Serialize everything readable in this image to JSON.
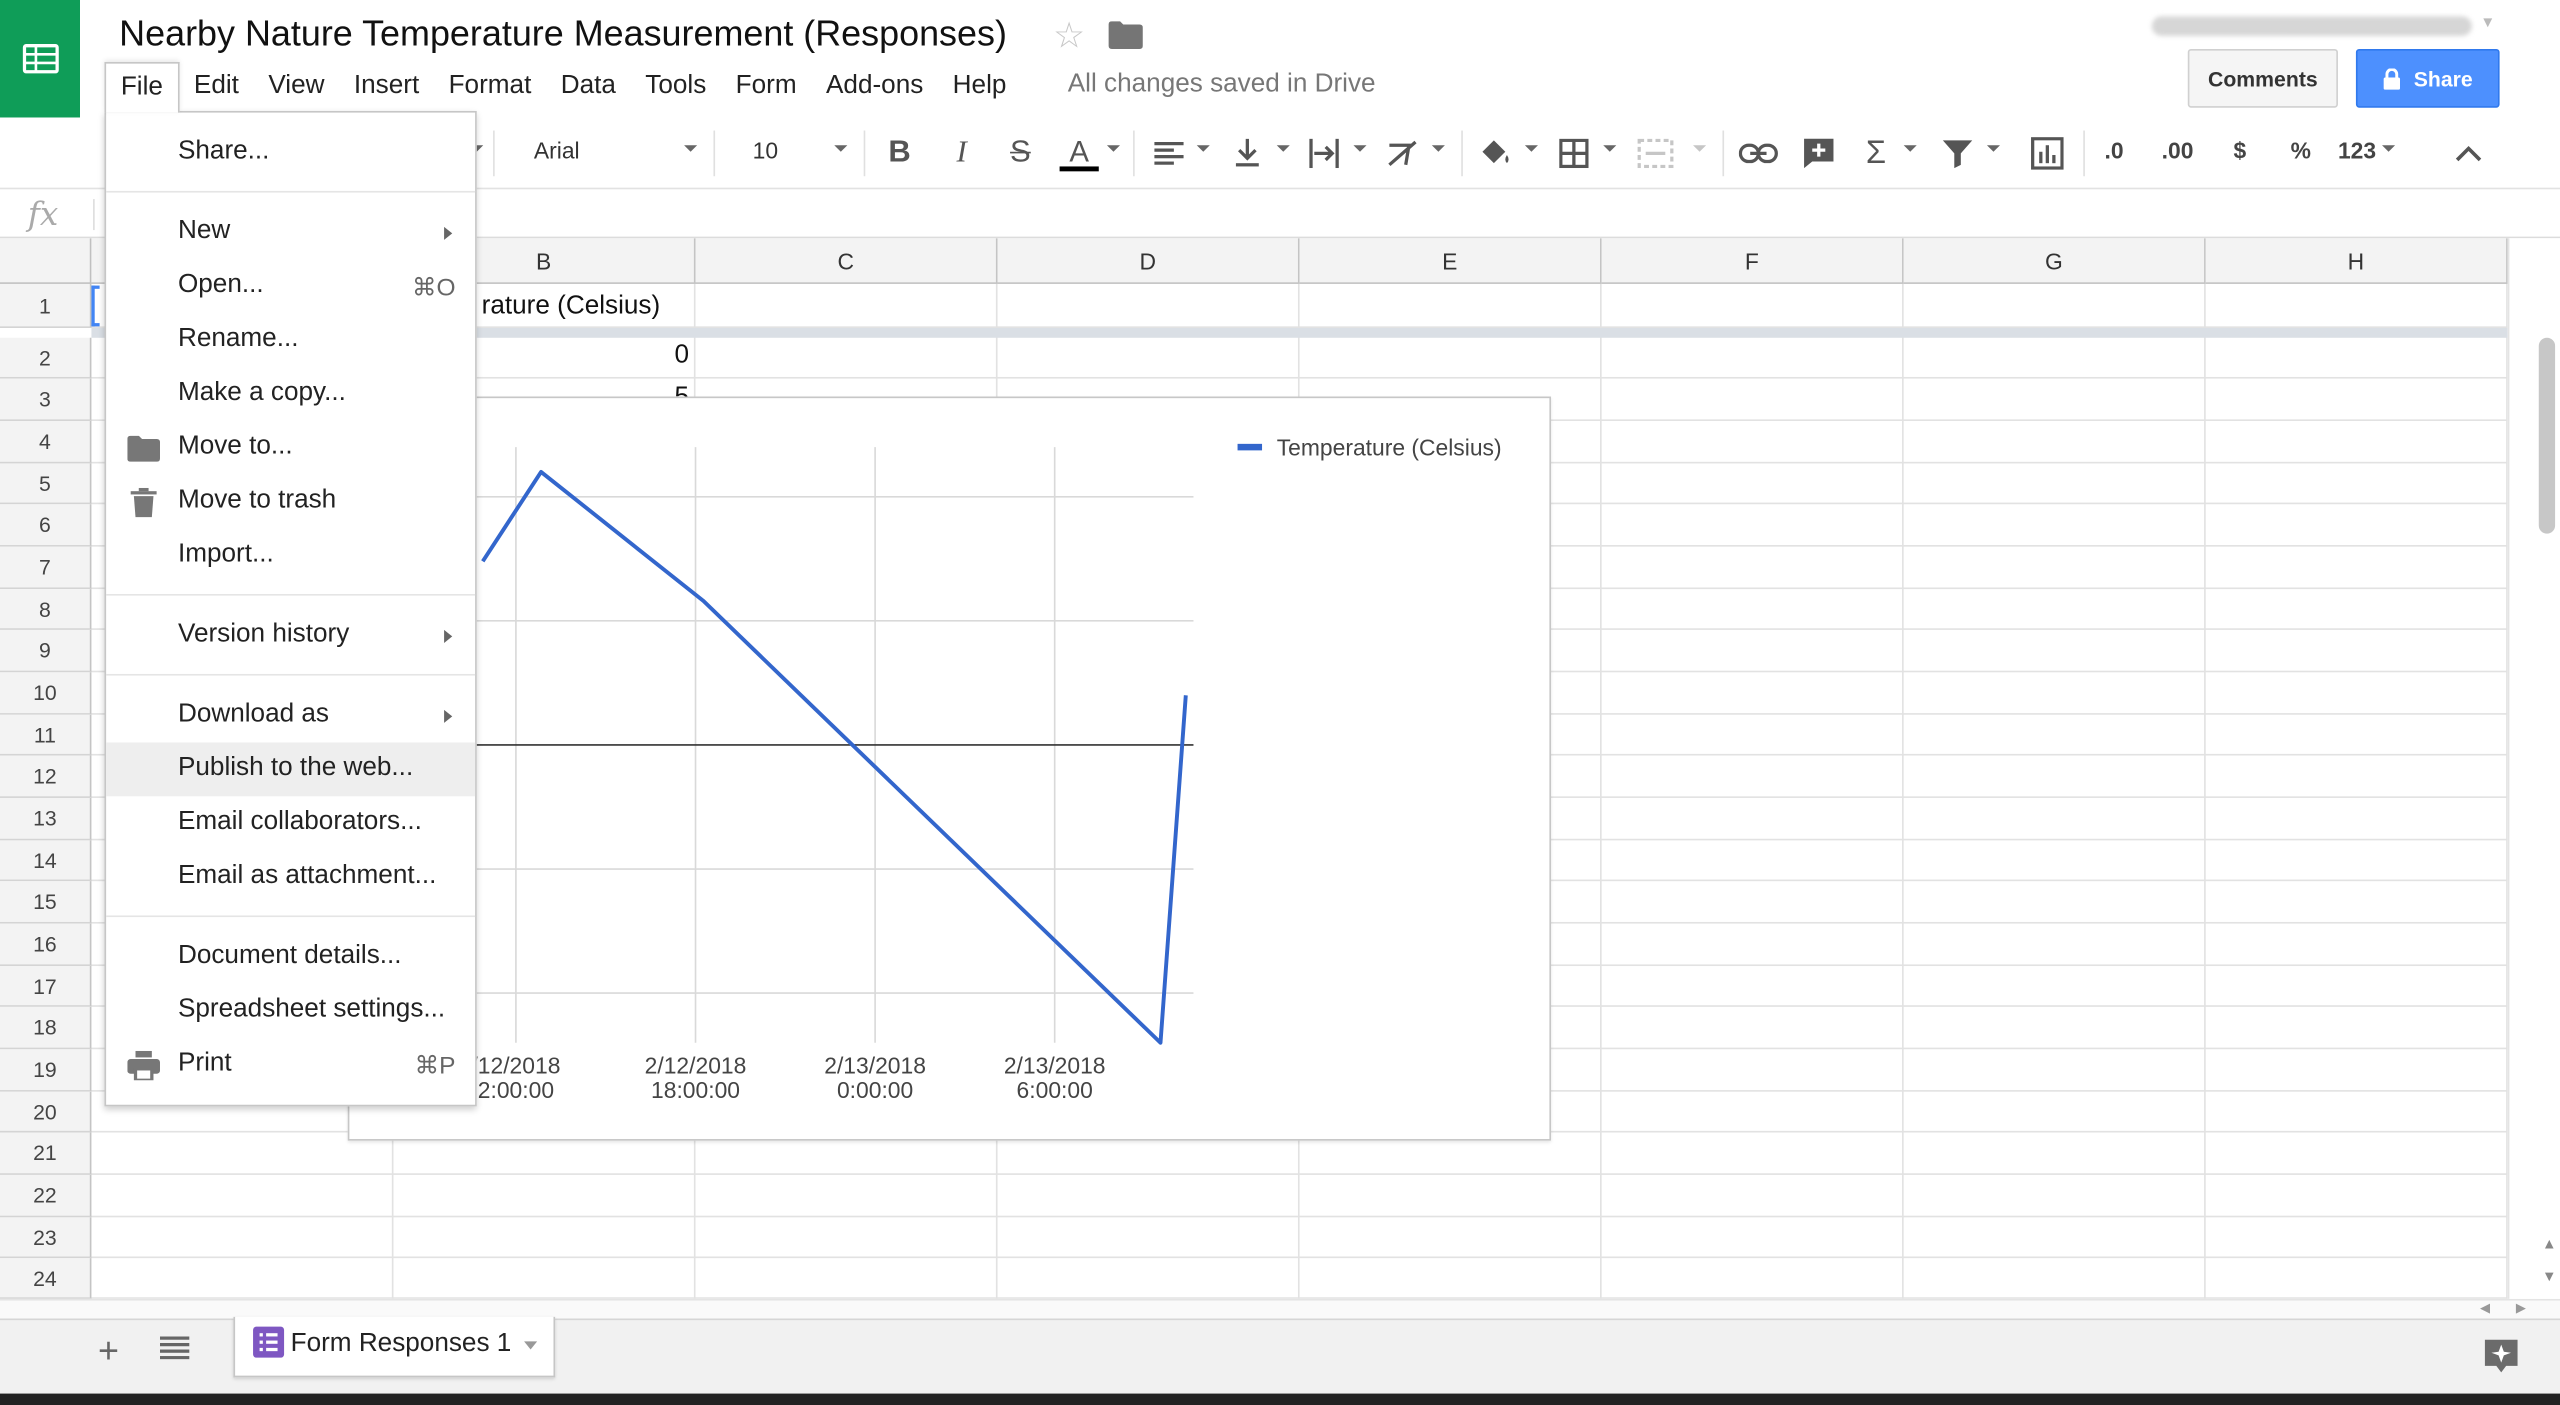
{
  "document": {
    "title": "Nearby Nature Temperature Measurement (Responses)",
    "save_status": "All changes saved in Drive"
  },
  "header": {
    "comments_label": "Comments",
    "share_label": "Share"
  },
  "menubar": [
    "File",
    "Edit",
    "View",
    "Insert",
    "Format",
    "Data",
    "Tools",
    "Form",
    "Add-ons",
    "Help"
  ],
  "toolbar": {
    "font": "Arial",
    "font_size": "10",
    "decimal_decrease": ".0",
    "decimal_increase": ".00",
    "currency": "$",
    "percent": "%",
    "more_formats": "123"
  },
  "formula_bar": {
    "fx": "fx"
  },
  "columns": [
    "B",
    "C",
    "D",
    "E",
    "F",
    "G",
    "H"
  ],
  "rows": [
    "1",
    "2",
    "3",
    "4",
    "5",
    "6",
    "7",
    "8",
    "9",
    "10",
    "11",
    "12",
    "13",
    "14",
    "15",
    "16",
    "17",
    "18",
    "19",
    "20",
    "21",
    "22",
    "23",
    "24"
  ],
  "cells": {
    "B1": "rature (Celsius)",
    "B2": "0",
    "B3": "5"
  },
  "file_menu": {
    "items": [
      {
        "label": "Share...",
        "shortcut": "",
        "submenu": false,
        "icon": ""
      },
      {
        "label": "New",
        "shortcut": "",
        "submenu": true,
        "icon": ""
      },
      {
        "label": "Open...",
        "shortcut": "⌘O",
        "submenu": false,
        "icon": ""
      },
      {
        "label": "Rename...",
        "shortcut": "",
        "submenu": false,
        "icon": ""
      },
      {
        "label": "Make a copy...",
        "shortcut": "",
        "submenu": false,
        "icon": ""
      },
      {
        "label": "Move to...",
        "shortcut": "",
        "submenu": false,
        "icon": "folder-icon"
      },
      {
        "label": "Move to trash",
        "shortcut": "",
        "submenu": false,
        "icon": "trash-icon"
      },
      {
        "label": "Import...",
        "shortcut": "",
        "submenu": false,
        "icon": ""
      },
      {
        "label": "Version history",
        "shortcut": "",
        "submenu": true,
        "icon": ""
      },
      {
        "label": "Download as",
        "shortcut": "",
        "submenu": true,
        "icon": ""
      },
      {
        "label": "Publish to the web...",
        "shortcut": "",
        "submenu": false,
        "icon": "",
        "highlighted": true
      },
      {
        "label": "Email collaborators...",
        "shortcut": "",
        "submenu": false,
        "icon": ""
      },
      {
        "label": "Email as attachment...",
        "shortcut": "",
        "submenu": false,
        "icon": ""
      },
      {
        "label": "Document details...",
        "shortcut": "",
        "submenu": false,
        "icon": ""
      },
      {
        "label": "Spreadsheet settings...",
        "shortcut": "",
        "submenu": false,
        "icon": ""
      },
      {
        "label": "Print",
        "shortcut": "⌘P",
        "submenu": false,
        "icon": "print-icon"
      }
    ]
  },
  "sheets": {
    "active_tab": "Form Responses 1"
  },
  "colors": {
    "brand_green": "#0f9d58",
    "share_blue": "#4d90fe",
    "series_blue": "#3366cc",
    "sheet_tab_purple": "#7e57c2"
  },
  "chart_data": {
    "type": "line",
    "title": "",
    "xlabel": "",
    "ylabel": "",
    "x_tick_labels": [
      [
        "/12/2018",
        "2:00:00"
      ],
      [
        "2/12/2018",
        "18:00:00"
      ],
      [
        "2/13/2018",
        "0:00:00"
      ],
      [
        "2/13/2018",
        "6:00:00"
      ]
    ],
    "series": [
      {
        "name": "Temperature (Celsius)",
        "color": "#3366cc",
        "points": [
          {
            "x": 0.3,
            "y": 7.4
          },
          {
            "x": 2.6,
            "y": 11.0
          },
          {
            "x": 9.0,
            "y": 5.8
          },
          {
            "x": 27.0,
            "y": -12.0
          },
          {
            "x": 28.0,
            "y": 2.0
          }
        ]
      }
    ],
    "x_range": [
      0,
      28.3
    ],
    "y_range": [
      -12,
      12
    ],
    "zero_baseline": 0,
    "legend_position": "top-right",
    "grid": true
  }
}
